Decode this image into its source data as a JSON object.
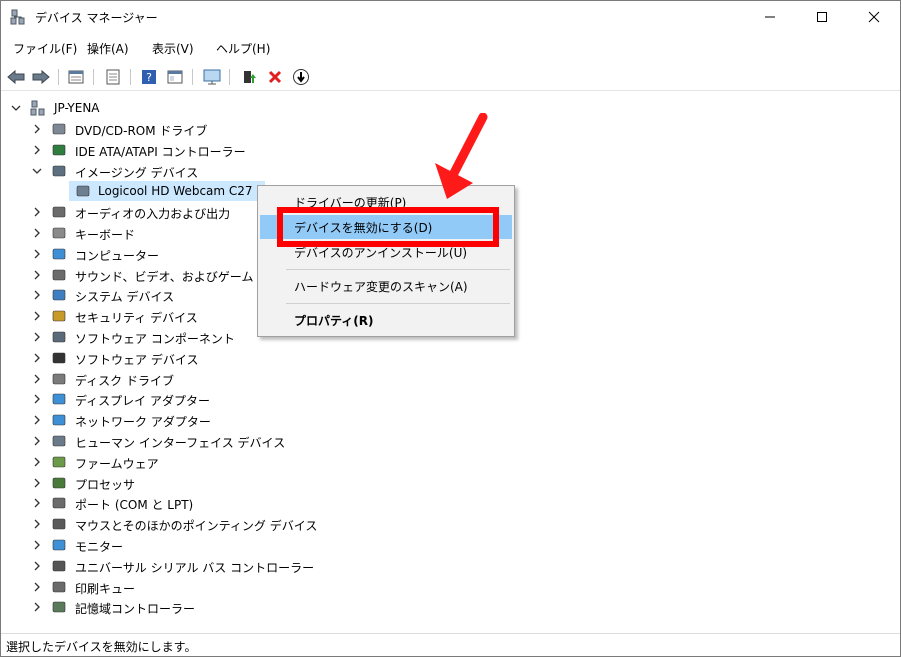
{
  "window": {
    "title": "デバイス マネージャー"
  },
  "menu": [
    "ファイル(F)",
    "操作(A)",
    "表示(V)",
    "ヘルプ(H)"
  ],
  "toolbar_icons": [
    "back-icon",
    "forward-icon",
    "properties-icon",
    "update-icon",
    "help-icon",
    "view-icon",
    "monitor-icon",
    "update-driver-icon",
    "uninstall-icon",
    "disable-icon"
  ],
  "tree": {
    "root": "JP-YENA",
    "categories": [
      "DVD/CD-ROM ドライブ",
      "IDE ATA/ATAPI コントローラー",
      "イメージング デバイス",
      "Logicool HD Webcam C27",
      "オーディオの入力および出力",
      "キーボード",
      "コンピューター",
      "サウンド、ビデオ、およびゲーム コン",
      "システム デバイス",
      "セキュリティ デバイス",
      "ソフトウェア コンポーネント",
      "ソフトウェア デバイス",
      "ディスク ドライブ",
      "ディスプレイ アダプター",
      "ネットワーク アダプター",
      "ヒューマン インターフェイス デバイス",
      "ファームウェア",
      "プロセッサ",
      "ポート (COM と LPT)",
      "マウスとそのほかのポインティング デバイス",
      "モニター",
      "ユニバーサル シリアル バス コントローラー",
      "印刷キュー",
      "記憶域コントローラー"
    ]
  },
  "context_menu": {
    "items": [
      "ドライバーの更新(P)",
      "デバイスを無効にする(D)",
      "デバイスのアンインストール(U)",
      "ハードウェア変更のスキャン(A)",
      "プロパティ(R)"
    ]
  },
  "status": "選択したデバイスを無効にします。",
  "colors": {
    "highlight": "#91c9f7",
    "selection": "#cce8ff",
    "annotation_red": "#ff0000"
  }
}
